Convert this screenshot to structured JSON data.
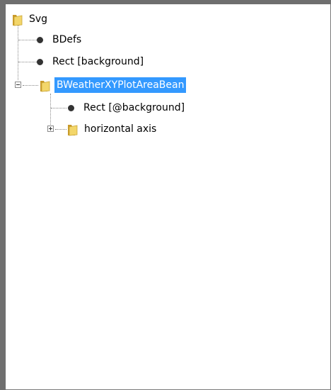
{
  "tree": {
    "root": {
      "label": "Svg",
      "icon": "folder-icon"
    },
    "items": [
      {
        "label": "BDefs",
        "icon": "node-dot-icon"
      },
      {
        "label": "Rect [background]",
        "icon": "node-dot-icon"
      },
      {
        "label": "BWeatherXYPlotAreaBean",
        "icon": "folder-icon",
        "expanded": true,
        "selected": true
      },
      {
        "label": "Rect [@background]",
        "icon": "node-dot-icon"
      },
      {
        "label": "horizontal axis",
        "icon": "folder-icon",
        "expanded": false
      }
    ]
  },
  "colors": {
    "selection": "#3399ff",
    "folder": "#e7c24a"
  }
}
